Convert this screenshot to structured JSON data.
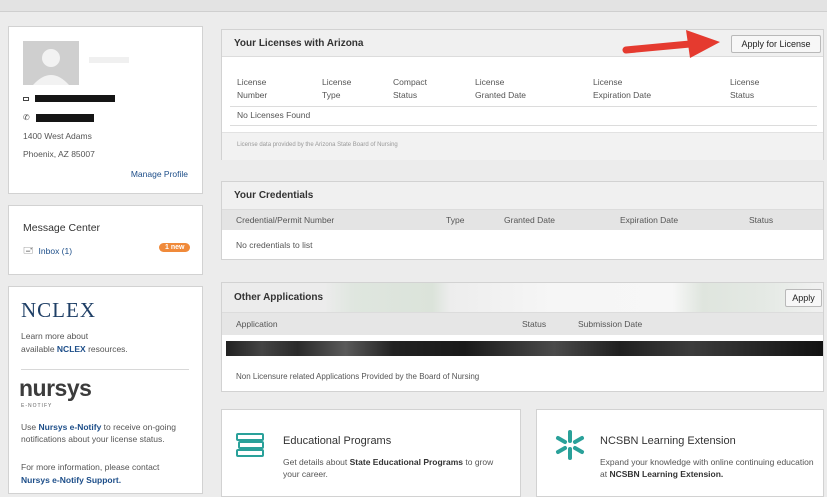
{
  "profile": {
    "address_line1": "1400 West Adams",
    "address_line2": "Phoenix, AZ 85007",
    "manage_profile": "Manage Profile"
  },
  "message_center": {
    "title": "Message Center",
    "inbox": "Inbox (1)",
    "badge": "1 new"
  },
  "nclex": {
    "logo": "NCLEX",
    "text_before": "Learn more about",
    "text_pre_link": "available ",
    "link": "NCLEX",
    "text_after": " resources."
  },
  "nursys": {
    "logo": "nursys",
    "logo_sub": "E-NOTIFY",
    "use_pre": "Use ",
    "use_link": "Nursys e-Notify",
    "use_post": " to receive on-going notifications about your license status.",
    "contact_pre": "For more information, please contact",
    "contact_link": "Nursys e-Notify Support."
  },
  "licenses": {
    "title": "Your Licenses with Arizona",
    "apply_button": "Apply for License",
    "columns": [
      [
        "License",
        "Number"
      ],
      [
        "License",
        "Type"
      ],
      [
        "Compact",
        "Status"
      ],
      [
        "License",
        "Granted Date"
      ],
      [
        "License",
        "Expiration Date"
      ],
      [
        "License",
        "Status"
      ]
    ],
    "empty": "No Licenses Found",
    "footer": "License data provided by the Arizona State Board of Nursing"
  },
  "credentials": {
    "title": "Your Credentials",
    "columns": [
      "Credential/Permit Number",
      "Type",
      "Granted Date",
      "Expiration Date",
      "Status"
    ],
    "empty": "No credentials to list"
  },
  "other_applications": {
    "title": "Other Applications",
    "apply_button": "Apply",
    "columns": [
      "Application",
      "Status",
      "Submission Date"
    ],
    "footer": "Non Licensure related Applications Provided by the Board of Nursing"
  },
  "educational_programs": {
    "title": "Educational Programs",
    "desc_pre": "Get details about ",
    "desc_bold": "State Educational Programs",
    "desc_post": " to grow your career."
  },
  "learning_extension": {
    "title": "NCSBN Learning Extension",
    "desc_pre": "Expand your knowledge with online continuing education at ",
    "desc_bold": "NCSBN Learning Extension."
  },
  "colors": {
    "link": "#1d4e89",
    "badge": "#f08a3a",
    "arrow": "#e53a2f",
    "icon_teal": "#2aa19a"
  }
}
